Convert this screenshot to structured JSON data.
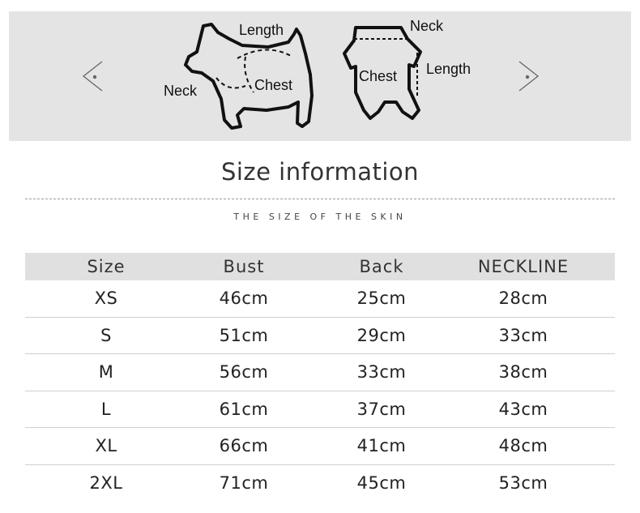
{
  "diagram": {
    "dog_labels": {
      "length": "Length",
      "neck": "Neck",
      "chest": "Chest"
    },
    "garment_labels": {
      "neck": "Neck",
      "length": "Length",
      "chest": "Chest"
    }
  },
  "title": "Size information",
  "subtitle": "THE SIZE OF THE SKIN",
  "table": {
    "headers": [
      "Size",
      "Bust",
      "Back",
      "NECKLINE"
    ],
    "rows": [
      [
        "XS",
        "46cm",
        "25cm",
        "28cm"
      ],
      [
        "S",
        "51cm",
        "29cm",
        "33cm"
      ],
      [
        "M",
        "56cm",
        "33cm",
        "38cm"
      ],
      [
        "L",
        "61cm",
        "37cm",
        "43cm"
      ],
      [
        "XL",
        "66cm",
        "41cm",
        "48cm"
      ],
      [
        "2XL",
        "71cm",
        "45cm",
        "53cm"
      ]
    ]
  }
}
